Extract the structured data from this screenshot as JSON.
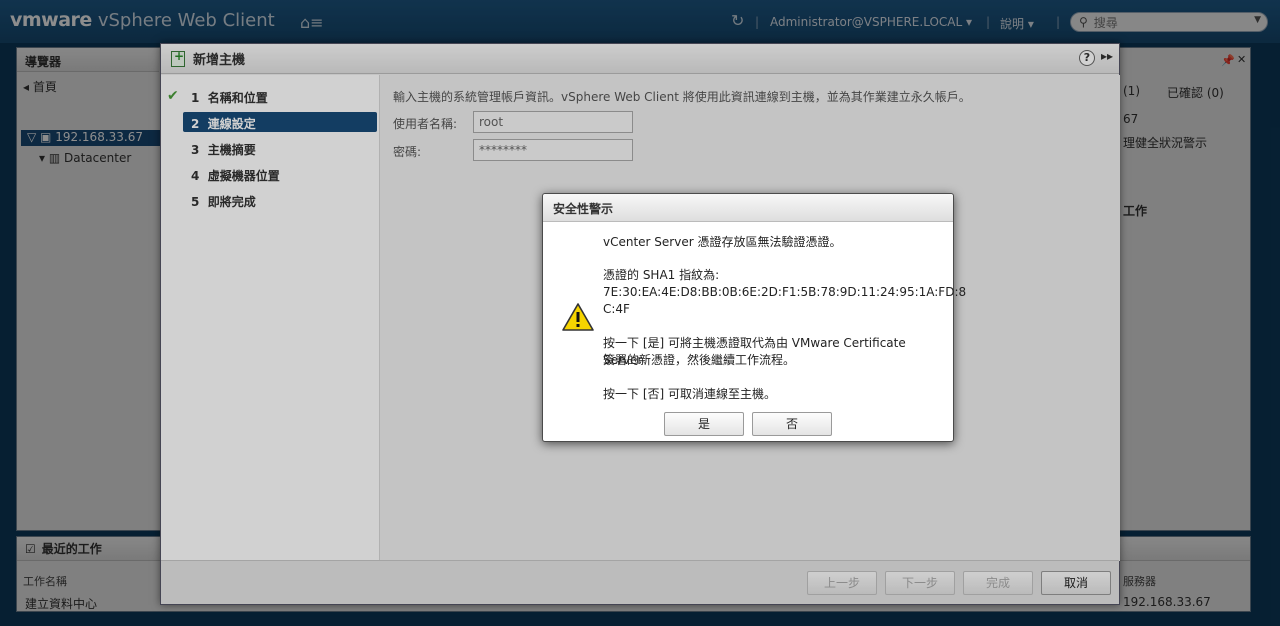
{
  "header": {
    "brand_vm": "vmware",
    "brand_product": "vSphere Web Client",
    "user": "Administrator@VSPHERE.LOCAL ▾",
    "help": "說明 ▾",
    "search_placeholder": "搜尋"
  },
  "background": {
    "navigator_title": "導覽器",
    "nav_back": "首頁",
    "tree_host": "192.168.33.67",
    "tree_datacenter": "Datacenter",
    "alarm_tab_all": "(1)",
    "alarm_tab_ack": "已確認 (0)",
    "alarm_host": "67",
    "alarm_text": "理健全狀況警示",
    "work_title_right": "工作",
    "recent_tasks_title": "最近的工作",
    "col_task_name": "工作名稱",
    "col_server": "服務器",
    "task_row_name": "建立資料中心",
    "task_row_server": "192.168.33.67"
  },
  "wizard": {
    "title": "新增主機",
    "steps": [
      {
        "num": "1",
        "label": "名稱和位置"
      },
      {
        "num": "2",
        "label": "連線設定"
      },
      {
        "num": "3",
        "label": "主機摘要"
      },
      {
        "num": "4",
        "label": "虛擬機器位置"
      },
      {
        "num": "5",
        "label": "即將完成"
      }
    ],
    "description": "輸入主機的系統管理帳戶資訊。vSphere Web Client 將使用此資訊連線到主機，並為其作業建立永久帳戶。",
    "username_label": "使用者名稱:",
    "username_value": "root",
    "password_label": "密碼:",
    "password_value": "********",
    "btn_back": "上一步",
    "btn_next": "下一步",
    "btn_finish": "完成",
    "btn_cancel": "取消"
  },
  "dialog": {
    "title": "安全性警示",
    "line1": "vCenter Server 憑證存放區無法驗證憑證。",
    "line2": "憑證的 SHA1 指紋為:",
    "line3": "7E:30:EA:4E:D8:BB:0B:6E:2D:F1:5B:78:9D:11:24:95:1A:FD:8",
    "line4": "C:4F",
    "line5": "按一下 [是] 可將主機憑證取代為由 VMware Certificate Server",
    "line6": "簽署的新憑證，然後繼續工作流程。",
    "line7": "按一下 [否] 可取消連線至主機。",
    "btn_yes": "是",
    "btn_no": "否"
  }
}
